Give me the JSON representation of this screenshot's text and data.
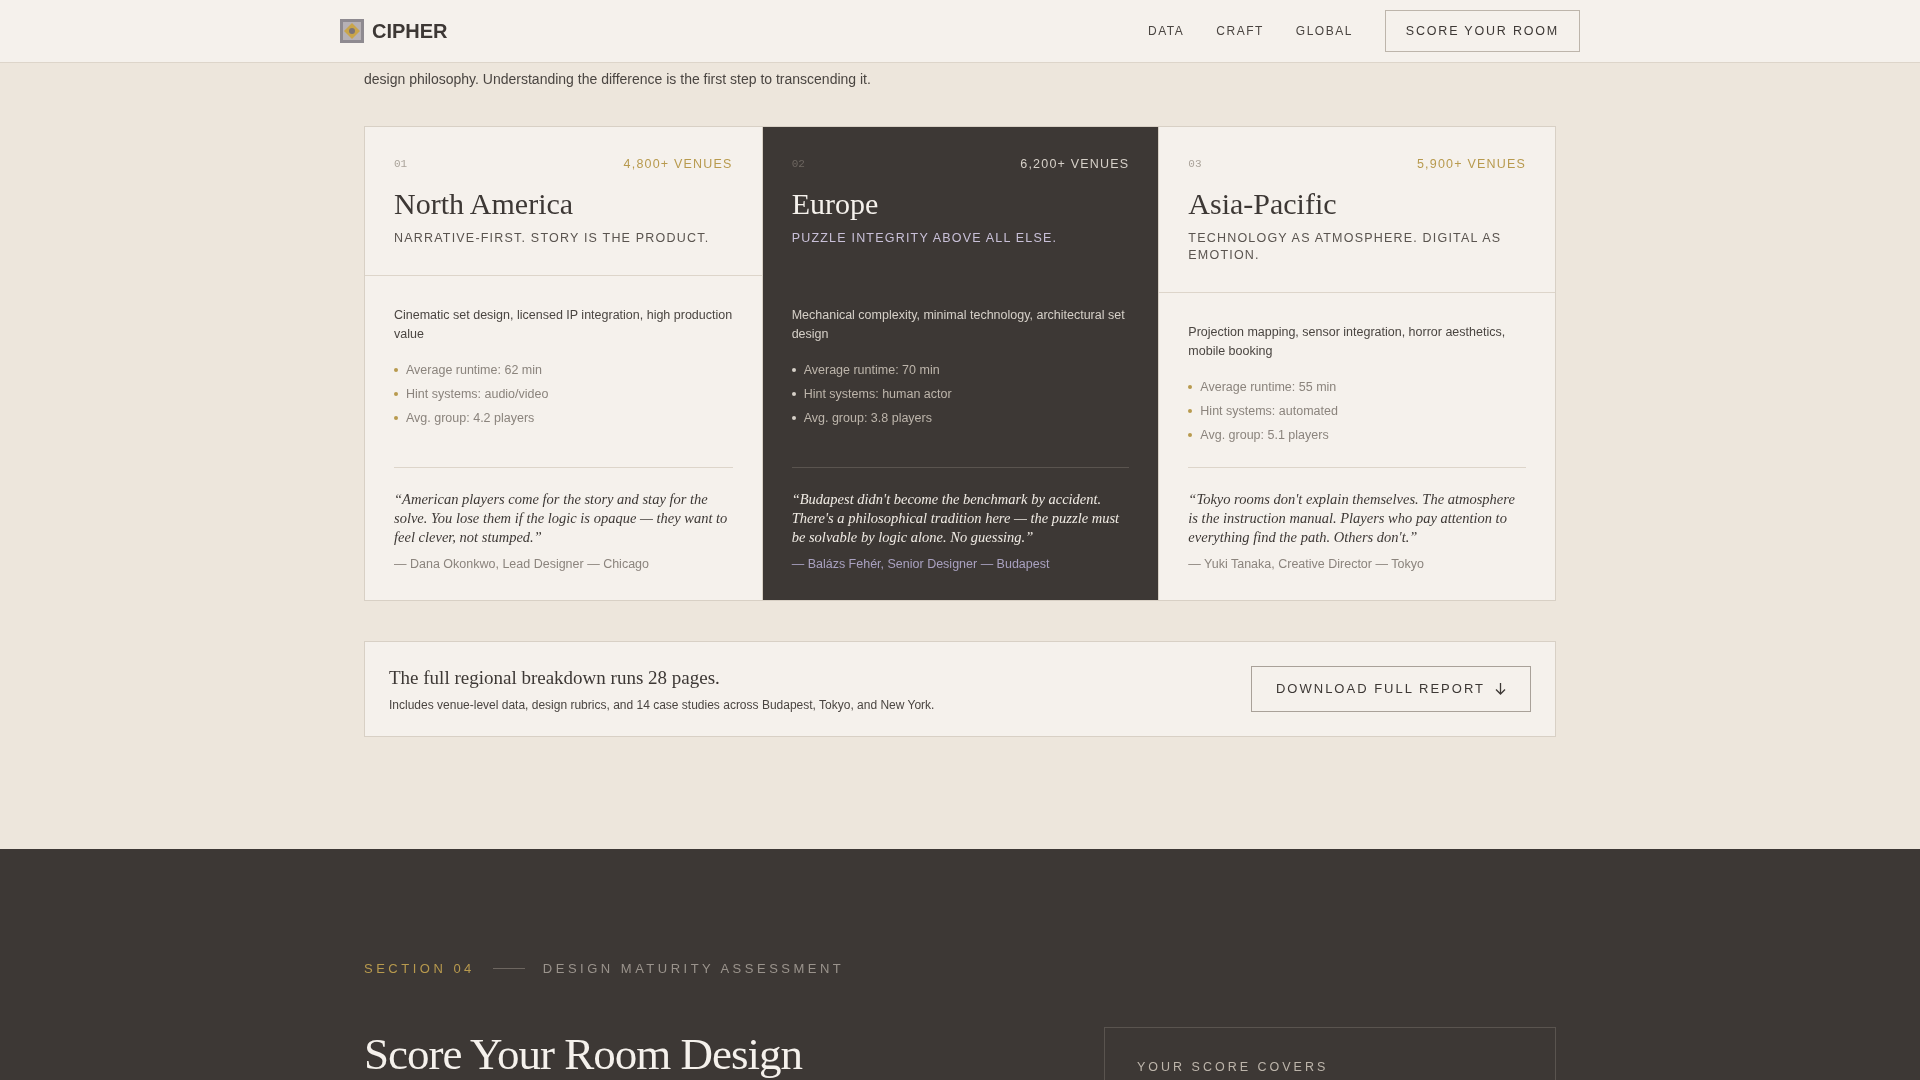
{
  "nav": {
    "brand": "CIPHER",
    "links": [
      "DATA",
      "CRAFT",
      "GLOBAL"
    ],
    "cta": "SCORE YOUR ROOM"
  },
  "intro": "design philosophy. Understanding the difference is the first step to transcending it.",
  "regions": [
    {
      "number": "01",
      "venues": "4,800+ VENUES",
      "name": "North America",
      "tagline": "NARRATIVE-FIRST. STORY IS THE PRODUCT.",
      "featured": false,
      "description": "Cinematic set design, licensed IP integration, high production value",
      "stats": [
        "Average runtime: 62 min",
        "Hint systems: audio/video",
        "Avg. group: 4.2 players"
      ],
      "quote": "“American players come for the story and stay for the solve. You lose them if the logic is opaque — they want to feel clever, not stumped.”",
      "attribution": "— Dana Okonkwo, Lead Designer — Chicago"
    },
    {
      "number": "02",
      "venues": "6,200+ VENUES",
      "name": "Europe",
      "tagline": "PUZZLE INTEGRITY ABOVE ALL ELSE.",
      "featured": true,
      "description": "Mechanical complexity, minimal technology, architectural set design",
      "stats": [
        "Average runtime: 70 min",
        "Hint systems: human actor",
        "Avg. group: 3.8 players"
      ],
      "quote": "“Budapest didn't become the benchmark by accident. There's a philosophical tradition here — the puzzle must be solvable by logic alone. No guessing.”",
      "attribution": "— Balázs Fehér, Senior Designer — Budapest"
    },
    {
      "number": "03",
      "venues": "5,900+ VENUES",
      "name": "Asia-Pacific",
      "tagline": "TECHNOLOGY AS ATMOSPHERE. DIGITAL AS EMOTION.",
      "featured": false,
      "description": "Projection mapping, sensor integration, horror aesthetics, mobile booking",
      "stats": [
        "Average runtime: 55 min",
        "Hint systems: automated",
        "Avg. group: 5.1 players"
      ],
      "quote": "“Tokyo rooms don't explain themselves. The atmosphere is the instruction manual. Players who pay attention to everything find the path. Others don't.”",
      "attribution": "— Yuki Tanaka, Creative Director — Tokyo"
    }
  ],
  "report": {
    "title": "The full regional breakdown runs 28 pages.",
    "text": "Includes venue-level data, design rubrics, and 14 case studies across Budapest, Tokyo, and New York.",
    "button": "DOWNLOAD FULL REPORT"
  },
  "section": {
    "label": "SECTION 04",
    "eyebrow": "DESIGN MATURITY ASSESSMENT",
    "title": "Score Your Room Design",
    "panel_title": "YOUR SCORE COVERS"
  }
}
